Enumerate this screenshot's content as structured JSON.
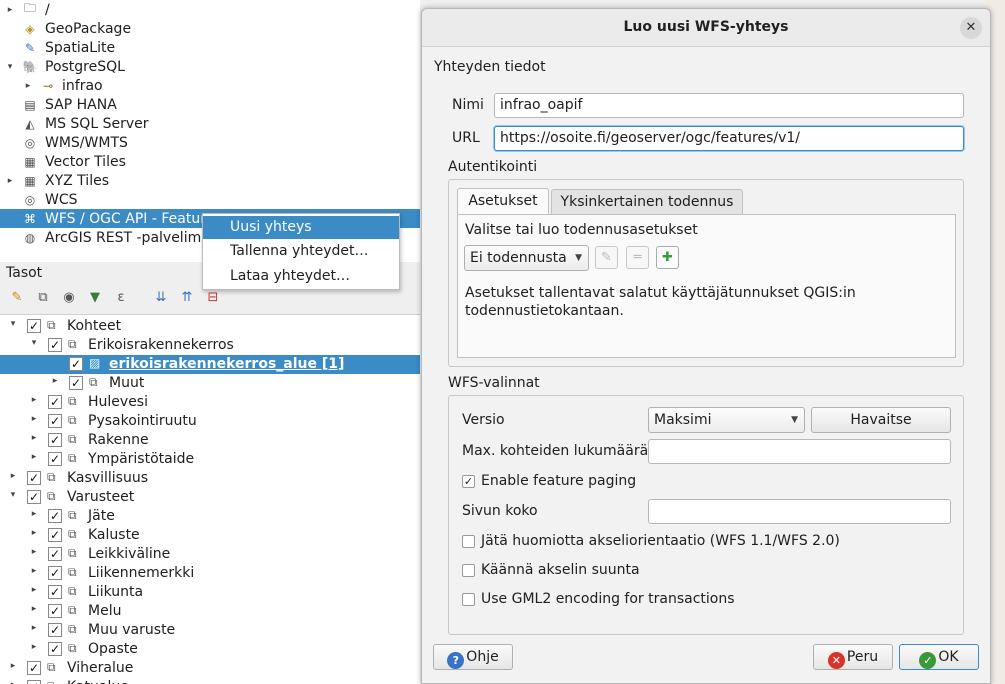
{
  "browser": {
    "items": [
      {
        "label": "/",
        "icon": "folder-icon",
        "arrow": "▸"
      },
      {
        "label": "GeoPackage",
        "icon": "geopackage-icon",
        "arrow": ""
      },
      {
        "label": "SpatiaLite",
        "icon": "spatialite-icon",
        "arrow": ""
      },
      {
        "label": "PostgreSQL",
        "icon": "postgresql-icon",
        "arrow": "▾"
      },
      {
        "label": "infrao",
        "icon": "schema-icon",
        "arrow": "▸"
      },
      {
        "label": "SAP HANA",
        "icon": "sap-hana-icon",
        "arrow": ""
      },
      {
        "label": "MS SQL Server",
        "icon": "mssql-icon",
        "arrow": ""
      },
      {
        "label": "WMS/WMTS",
        "icon": "wms-icon",
        "arrow": ""
      },
      {
        "label": "Vector Tiles",
        "icon": "vector-tiles-icon",
        "arrow": ""
      },
      {
        "label": "XYZ Tiles",
        "icon": "xyz-tiles-icon",
        "arrow": "▸"
      },
      {
        "label": "WCS",
        "icon": "wcs-icon",
        "arrow": ""
      },
      {
        "label": "WFS / OGC API - Featur",
        "icon": "wfs-icon",
        "arrow": ""
      },
      {
        "label": "ArcGIS REST -palvelime",
        "icon": "arcgis-icon",
        "arrow": ""
      }
    ]
  },
  "context_menu": {
    "items": [
      "Uusi yhteys",
      "Tallenna yhteydet…",
      "Lataa yhteydet…"
    ]
  },
  "layers": {
    "title": "Tasot",
    "rows": [
      {
        "label": "Kohteet",
        "level": 0,
        "arrow": "▾",
        "checked": true
      },
      {
        "label": "Erikoisrakennekerros",
        "level": 1,
        "arrow": "▾",
        "checked": true
      },
      {
        "label": "erikoisrakennekerros_alue [1]",
        "level": 2,
        "arrow": "",
        "checked": true,
        "selected": true
      },
      {
        "label": "Muut",
        "level": 2,
        "arrow": "▸",
        "checked": true
      },
      {
        "label": "Hulevesi",
        "level": 1,
        "arrow": "▸",
        "checked": true
      },
      {
        "label": "Pysakointiruutu",
        "level": 1,
        "arrow": "▸",
        "checked": true
      },
      {
        "label": "Rakenne",
        "level": 1,
        "arrow": "▸",
        "checked": true
      },
      {
        "label": "Ympäristötaide",
        "level": 1,
        "arrow": "▸",
        "checked": true
      },
      {
        "label": "Kasvillisuus",
        "level": 0,
        "arrow": "▸",
        "checked": true
      },
      {
        "label": "Varusteet",
        "level": 0,
        "arrow": "▾",
        "checked": true
      },
      {
        "label": "Jäte",
        "level": 1,
        "arrow": "▸",
        "checked": true
      },
      {
        "label": "Kaluste",
        "level": 1,
        "arrow": "▸",
        "checked": true
      },
      {
        "label": "Leikkiväline",
        "level": 1,
        "arrow": "▸",
        "checked": true
      },
      {
        "label": "Liikennemerkki",
        "level": 1,
        "arrow": "▸",
        "checked": true
      },
      {
        "label": "Liikunta",
        "level": 1,
        "arrow": "▸",
        "checked": true
      },
      {
        "label": "Melu",
        "level": 1,
        "arrow": "▸",
        "checked": true
      },
      {
        "label": "Muu varuste",
        "level": 1,
        "arrow": "▸",
        "checked": true
      },
      {
        "label": "Opaste",
        "level": 1,
        "arrow": "▸",
        "checked": true
      },
      {
        "label": "Viheralue",
        "level": 0,
        "arrow": "▸",
        "checked": true
      },
      {
        "label": "Katualue",
        "level": 0,
        "arrow": "▸",
        "checked": true
      }
    ]
  },
  "dialog": {
    "title": "Luo uusi WFS-yhteys",
    "close_icon": "✕",
    "connection_group": "Yhteyden tiedot",
    "name_label": "Nimi",
    "name_value": "infrao_oapif",
    "url_label": "URL",
    "url_value": "https://osoite.fi/geoserver/ogc/features/v1/",
    "auth_group": "Autentikointi",
    "tab_settings": "Asetukset",
    "tab_basic": "Yksinkertainen todennus",
    "auth_choose": "Valitse tai luo todennusasetukset",
    "auth_combo": "Ei todennusta",
    "auth_note": "Asetukset tallentavat salatut käyttäjätunnukset QGIS:in todennustietokantaan.",
    "wfs_group": "WFS-valinnat",
    "version_label": "Versio",
    "version_value": "Maksimi",
    "detect_button": "Havaitse",
    "max_features_label": "Max. kohteiden lukumäärä",
    "max_features_value": "",
    "paging_label": "Enable feature paging",
    "paging_checked": true,
    "page_size_label": "Sivun koko",
    "page_size_value": "",
    "ignore_axis_label": "Jätä huomiotta akseliorientaatio (WFS 1.1/WFS 2.0)",
    "invert_axis_label": "Käännä akselin suunta",
    "gml2_label": "Use GML2 encoding for transactions",
    "help_button": "Ohje",
    "cancel_button": "Peru",
    "ok_button": "OK"
  },
  "colors": {
    "selection": "#3b8bc6",
    "help": "#3b73c4",
    "cancel": "#d9342b",
    "ok": "#3a9a3a"
  }
}
